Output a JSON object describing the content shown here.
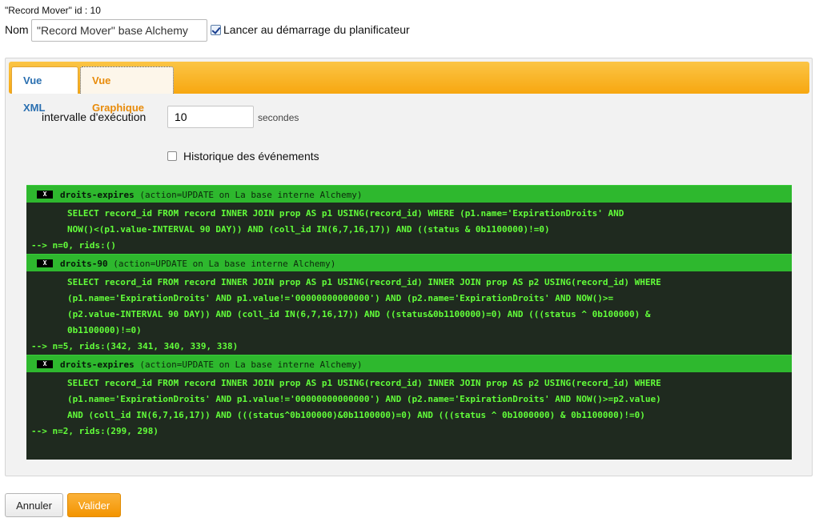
{
  "header": {
    "id_line": "\"Record Mover\" id : 10",
    "nom_label": "Nom",
    "nom_value": "\"Record Mover\" base Alchemy",
    "autostart_label": "Lancer au démarrage du planificateur"
  },
  "tabs": {
    "xml": "Vue XML",
    "graphique": "Vue Graphique"
  },
  "settings": {
    "interval_label": "intervalle d'exécution",
    "interval_value": "10",
    "interval_unit": "secondes",
    "history_label": "Historique des événements"
  },
  "tasks": [
    {
      "icon": "X",
      "name": "droits-expires",
      "action": "(action=UPDATE on La base interne Alchemy)",
      "sql": [
        "SELECT record_id FROM record INNER JOIN prop AS p1 USING(record_id) WHERE (p1.name='ExpirationDroits' AND",
        "NOW()<(p1.value-INTERVAL 90 DAY)) AND (coll_id IN(6,7,16,17)) AND ((status & 0b1100000)!=0)"
      ],
      "result": "--> n=0, rids:()"
    },
    {
      "icon": "X",
      "name": "droits-90",
      "action": "(action=UPDATE on La base interne Alchemy)",
      "sql": [
        "SELECT record_id FROM record INNER JOIN prop AS p1 USING(record_id) INNER JOIN prop AS p2 USING(record_id) WHERE",
        "(p1.name='ExpirationDroits' AND p1.value!='00000000000000') AND (p2.name='ExpirationDroits' AND NOW()>=",
        "(p2.value-INTERVAL 90 DAY)) AND (coll_id IN(6,7,16,17)) AND ((status&0b1100000)=0) AND (((status ^ 0b100000) &",
        "0b1100000)!=0)"
      ],
      "result": "--> n=5, rids:(342, 341, 340, 339, 338)"
    },
    {
      "icon": "X",
      "name": "droits-expires",
      "action": "(action=UPDATE on La base interne Alchemy)",
      "sql": [
        "SELECT record_id FROM record INNER JOIN prop AS p1 USING(record_id) INNER JOIN prop AS p2 USING(record_id) WHERE",
        "(p1.name='ExpirationDroits' AND p1.value!='00000000000000') AND (p2.name='ExpirationDroits' AND NOW()>=p2.value)",
        "AND (coll_id IN(6,7,16,17)) AND (((status^0b100000)&0b1100000)=0) AND (((status ^ 0b1000000) & 0b1100000)!=0)"
      ],
      "result": "--> n=2, rids:(299, 298)"
    }
  ],
  "buttons": {
    "cancel": "Annuler",
    "ok": "Valider"
  },
  "colors": {
    "accent_orange": "#f7a710",
    "console_bg": "#1f2a1f",
    "console_text": "#62ff3a",
    "task_header": "#2eb82e"
  }
}
